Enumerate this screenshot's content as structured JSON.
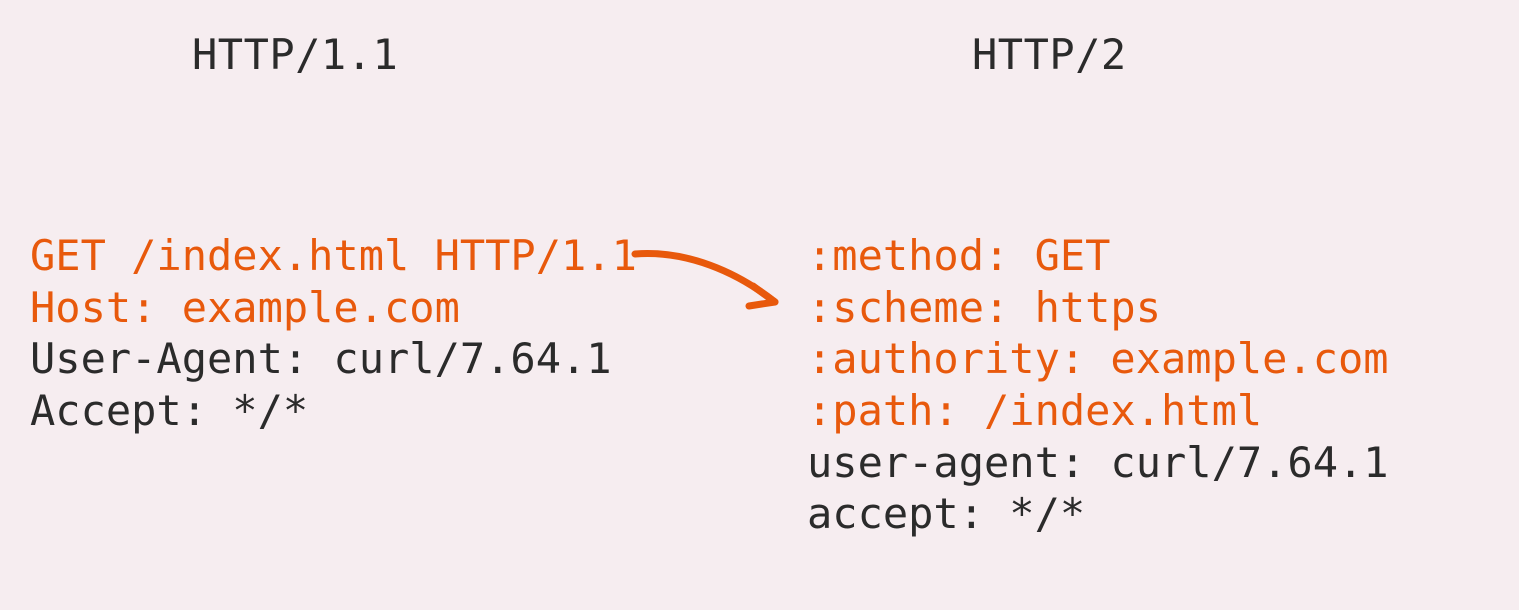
{
  "colors": {
    "background": "#f6edf0",
    "highlight": "#e8590c",
    "text": "#2b2b2b"
  },
  "left": {
    "title": "HTTP/1.1",
    "lines": [
      {
        "text": "GET /index.html HTTP/1.1",
        "highlight": true
      },
      {
        "text": "Host: example.com",
        "highlight": true
      },
      {
        "text": "User-Agent: curl/7.64.1",
        "highlight": false
      },
      {
        "text": "Accept: */*",
        "highlight": false
      }
    ]
  },
  "right": {
    "title": "HTTP/2",
    "lines": [
      {
        "text": ":method: GET",
        "highlight": true
      },
      {
        "text": ":scheme: https",
        "highlight": true
      },
      {
        "text": ":authority: example.com",
        "highlight": true
      },
      {
        "text": ":path: /index.html",
        "highlight": true
      },
      {
        "text": "user-agent: curl/7.64.1",
        "highlight": false
      },
      {
        "text": "accept: */*",
        "highlight": false
      }
    ]
  }
}
